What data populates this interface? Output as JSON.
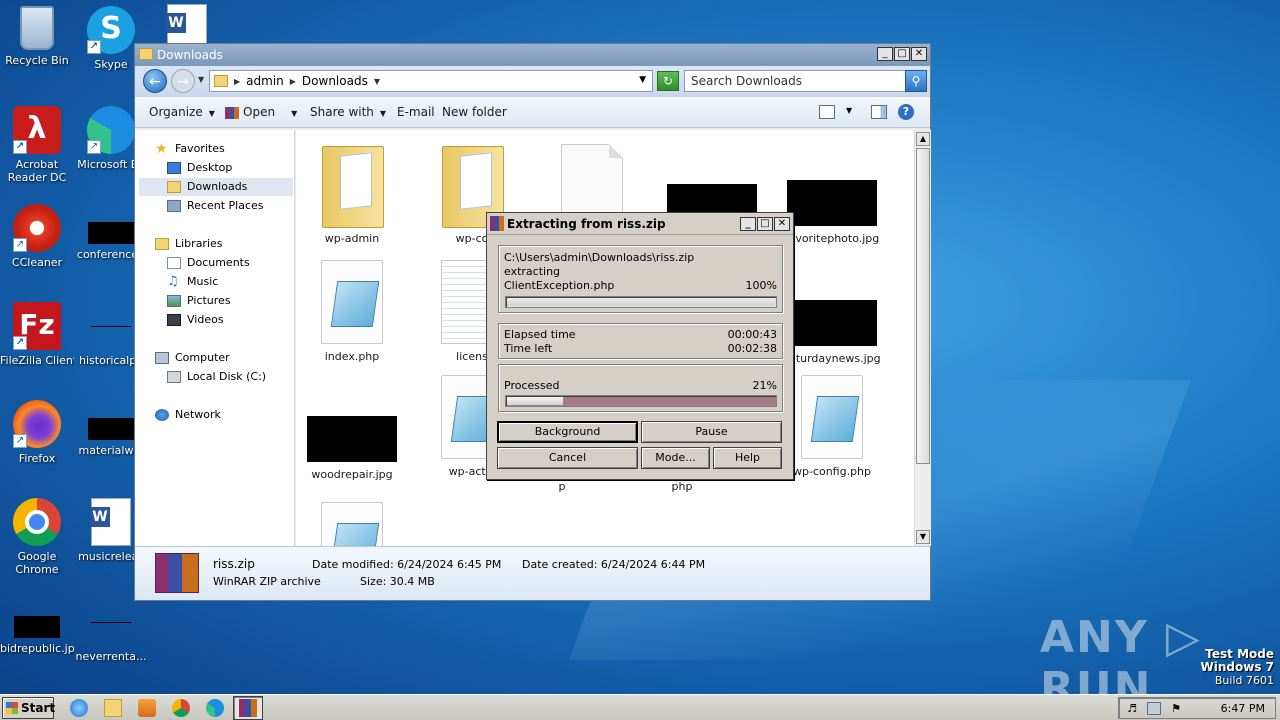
{
  "desktop": {
    "icons": [
      {
        "label": "Recycle Bin"
      },
      {
        "label": "Skype"
      },
      {
        "label": "Acrobat Reader DC"
      },
      {
        "label": "Microsoft Ed"
      },
      {
        "label": "CCleaner"
      },
      {
        "label": "conferenced"
      },
      {
        "label": "FileZilla Client"
      },
      {
        "label": "historicalpa"
      },
      {
        "label": "Firefox"
      },
      {
        "label": "materialwin"
      },
      {
        "label": "Google Chrome"
      },
      {
        "label": "musicreleas"
      },
      {
        "label": "bidrepublic.jpg"
      },
      {
        "label": "neverrenta..."
      }
    ],
    "watermark": "ANY ▷ RUN",
    "os_info": {
      "line1": "Test Mode",
      "line2": "Windows 7",
      "line3": "Build 7601"
    }
  },
  "explorer": {
    "title": "Downloads",
    "breadcrumb": [
      "admin",
      "Downloads"
    ],
    "search_placeholder": "Search Downloads",
    "commands": {
      "organize": "Organize",
      "open": "Open",
      "share": "Share with",
      "email": "E-mail",
      "new_folder": "New folder"
    },
    "nav": {
      "favorites": "Favorites",
      "desktop": "Desktop",
      "downloads": "Downloads",
      "recent": "Recent Places",
      "libraries": "Libraries",
      "documents": "Documents",
      "music": "Music",
      "pictures": "Pictures",
      "videos": "Videos",
      "computer": "Computer",
      "local_disk": "Local Disk (C:)",
      "network": "Network"
    },
    "files": {
      "wp_admin": "wp-admin",
      "wp_content": "wp-co",
      "favoritephoto": "favoritephoto.jpg",
      "index": "index.php",
      "license": "licens",
      "saturdaynews": "saturdaynews.jpg",
      "woodrepair": "woodrepair.jpg",
      "wp_activate": "wp-activ",
      "p_suffix": "p",
      "php_suffix": "php",
      "wp_config": "wp-config.php"
    },
    "details": {
      "name": "riss.zip",
      "type": "WinRAR ZIP archive",
      "date_modified": "Date modified: 6/24/2024 6:45 PM",
      "size": "Size: 30.4 MB",
      "date_created": "Date created: 6/24/2024 6:44 PM"
    }
  },
  "winrar": {
    "title": "Extracting from riss.zip",
    "archive_path": "C:\\Users\\admin\\Downloads\\riss.zip",
    "action": "extracting",
    "current_file": "ClientException.php",
    "file_percent_label": "100%",
    "file_progress": 1.0,
    "elapsed_label": "Elapsed time",
    "elapsed": "00:00:43",
    "left_label": "Time left",
    "left": "00:02:38",
    "processed_label": "Processed",
    "processed_percent_label": "21%",
    "processed_progress": 0.21,
    "buttons": {
      "background": "Background",
      "pause": "Pause",
      "cancel": "Cancel",
      "mode": "Mode...",
      "help": "Help"
    }
  },
  "taskbar": {
    "start": "Start",
    "clock": "6:47 PM"
  }
}
